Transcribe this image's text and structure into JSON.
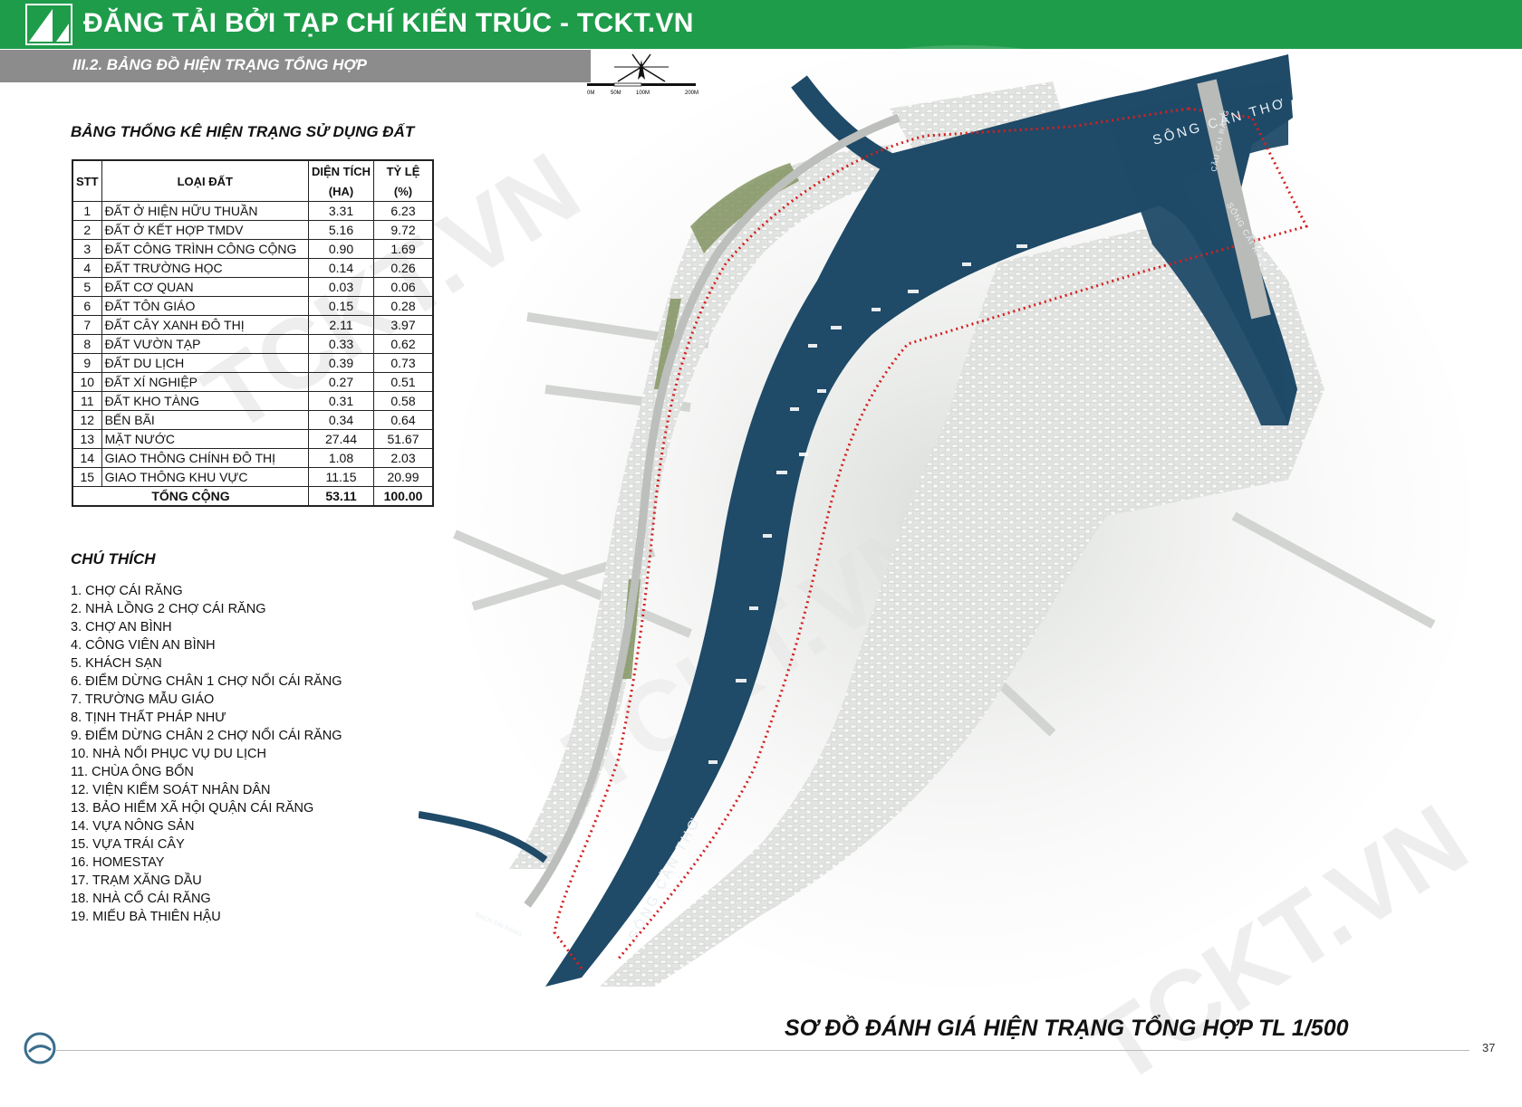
{
  "header": {
    "title": "ĐĂNG TẢI BỞI TẠP CHÍ KIẾN TRÚC - TCKT.VN"
  },
  "section": {
    "title": "III.2. BẢNG ĐỒ HIỆN TRẠNG TỔNG HỢP"
  },
  "stats_table": {
    "title": "BẢNG THỐNG KÊ HIỆN TRẠNG SỬ DỤNG ĐẤT",
    "headers": {
      "stt": "STT",
      "type": "LOẠI ĐẤT",
      "area": "DIỆN TÍCH",
      "area_unit": "(HA)",
      "ratio": "TỶ LỆ",
      "ratio_unit": "(%)"
    },
    "rows": [
      {
        "stt": "1",
        "type": "ĐẤT Ở HIỆN HỮU THUẦN",
        "area": "3.31",
        "ratio": "6.23"
      },
      {
        "stt": "2",
        "type": "ĐẤT Ở KẾT HỢP TMDV",
        "area": "5.16",
        "ratio": "9.72"
      },
      {
        "stt": "3",
        "type": "ĐẤT CÔNG TRÌNH CÔNG CỘNG",
        "area": "0.90",
        "ratio": "1.69"
      },
      {
        "stt": "4",
        "type": "ĐẤT TRƯỜNG HỌC",
        "area": "0.14",
        "ratio": "0.26"
      },
      {
        "stt": "5",
        "type": "ĐẤT CƠ QUAN",
        "area": "0.03",
        "ratio": "0.06"
      },
      {
        "stt": "6",
        "type": "ĐẤT TÔN GIÁO",
        "area": "0.15",
        "ratio": "0.28"
      },
      {
        "stt": "7",
        "type": "ĐẤT CÂY XANH ĐÔ THỊ",
        "area": "2.11",
        "ratio": "3.97"
      },
      {
        "stt": "8",
        "type": "ĐẤT VƯỜN TẠP",
        "area": "0.33",
        "ratio": "0.62"
      },
      {
        "stt": "9",
        "type": "ĐẤT DU LỊCH",
        "area": "0.39",
        "ratio": "0.73"
      },
      {
        "stt": "10",
        "type": "ĐẤT XÍ NGHIỆP",
        "area": "0.27",
        "ratio": "0.51"
      },
      {
        "stt": "11",
        "type": "ĐẤT KHO TÀNG",
        "area": "0.31",
        "ratio": "0.58"
      },
      {
        "stt": "12",
        "type": "BẾN BÃI",
        "area": "0.34",
        "ratio": "0.64"
      },
      {
        "stt": "13",
        "type": "MẶT NƯỚC",
        "area": "27.44",
        "ratio": "51.67"
      },
      {
        "stt": "14",
        "type": "GIAO THÔNG CHÍNH ĐÔ THỊ",
        "area": "1.08",
        "ratio": "2.03"
      },
      {
        "stt": "15",
        "type": "GIAO THÔNG KHU VỰC",
        "area": "11.15",
        "ratio": "20.99"
      }
    ],
    "total": {
      "label": "TỔNG CỘNG",
      "area": "53.11",
      "ratio": "100.00"
    }
  },
  "legend": {
    "title": "CHÚ THÍCH",
    "items": [
      "1. CHỢ CÁI RĂNG",
      "2. NHÀ LỒNG 2 CHỢ CÁI RĂNG",
      "3. CHỢ AN BÌNH",
      "4. CÔNG VIÊN AN BÌNH",
      "5. KHÁCH SẠN",
      "6. ĐIỂM DỪNG CHÂN 1 CHỢ NỔI CÁI RĂNG",
      "7. TRƯỜNG MẪU GIÁO",
      "8. TỊNH THẤT PHÁP NHƯ",
      "9. ĐIỂM DỪNG CHÂN 2 CHỢ NỔI CÁI RĂNG",
      "10. NHÀ NỔI PHỤC VỤ DU LỊCH",
      "11. CHÙA ÔNG BỔN",
      "12. VIỆN KIỂM SOÁT NHÂN DÂN",
      "13. BẢO HIỂM XÃ HỘI QUẬN CÁI RĂNG",
      "14. VỰA NÔNG SẢN",
      "15. VỰA TRÁI CÂY",
      "16. HOMESTAY",
      "17. TRẠM XĂNG DẦU",
      "18. NHÀ CỔ CÁI RĂNG",
      "19. MIẾU BÀ THIÊN HẬU"
    ]
  },
  "map": {
    "title": "SƠ ĐỒ ĐÁNH GIÁ HIỆN TRẠNG TỔNG HỢP TL 1/500",
    "river_label_main": "SÔNG CẦN THƠ",
    "river_label_lower": "SÔNG CẦN THƠ",
    "river_label_right": "SÔNG CÁI RĂNG",
    "bridge_label": "CẦU CÁI RĂNG",
    "canal_label": "RẠCH CÁI RĂNG",
    "scale_labels": [
      "0M",
      "50M",
      "100M",
      "200M"
    ],
    "colors": {
      "water": "#1f4a68",
      "route": "#d42020",
      "land": "#e6e8e4",
      "green": "#7d8f5a"
    }
  },
  "watermark": "TCKT.VN",
  "page_number": "37"
}
